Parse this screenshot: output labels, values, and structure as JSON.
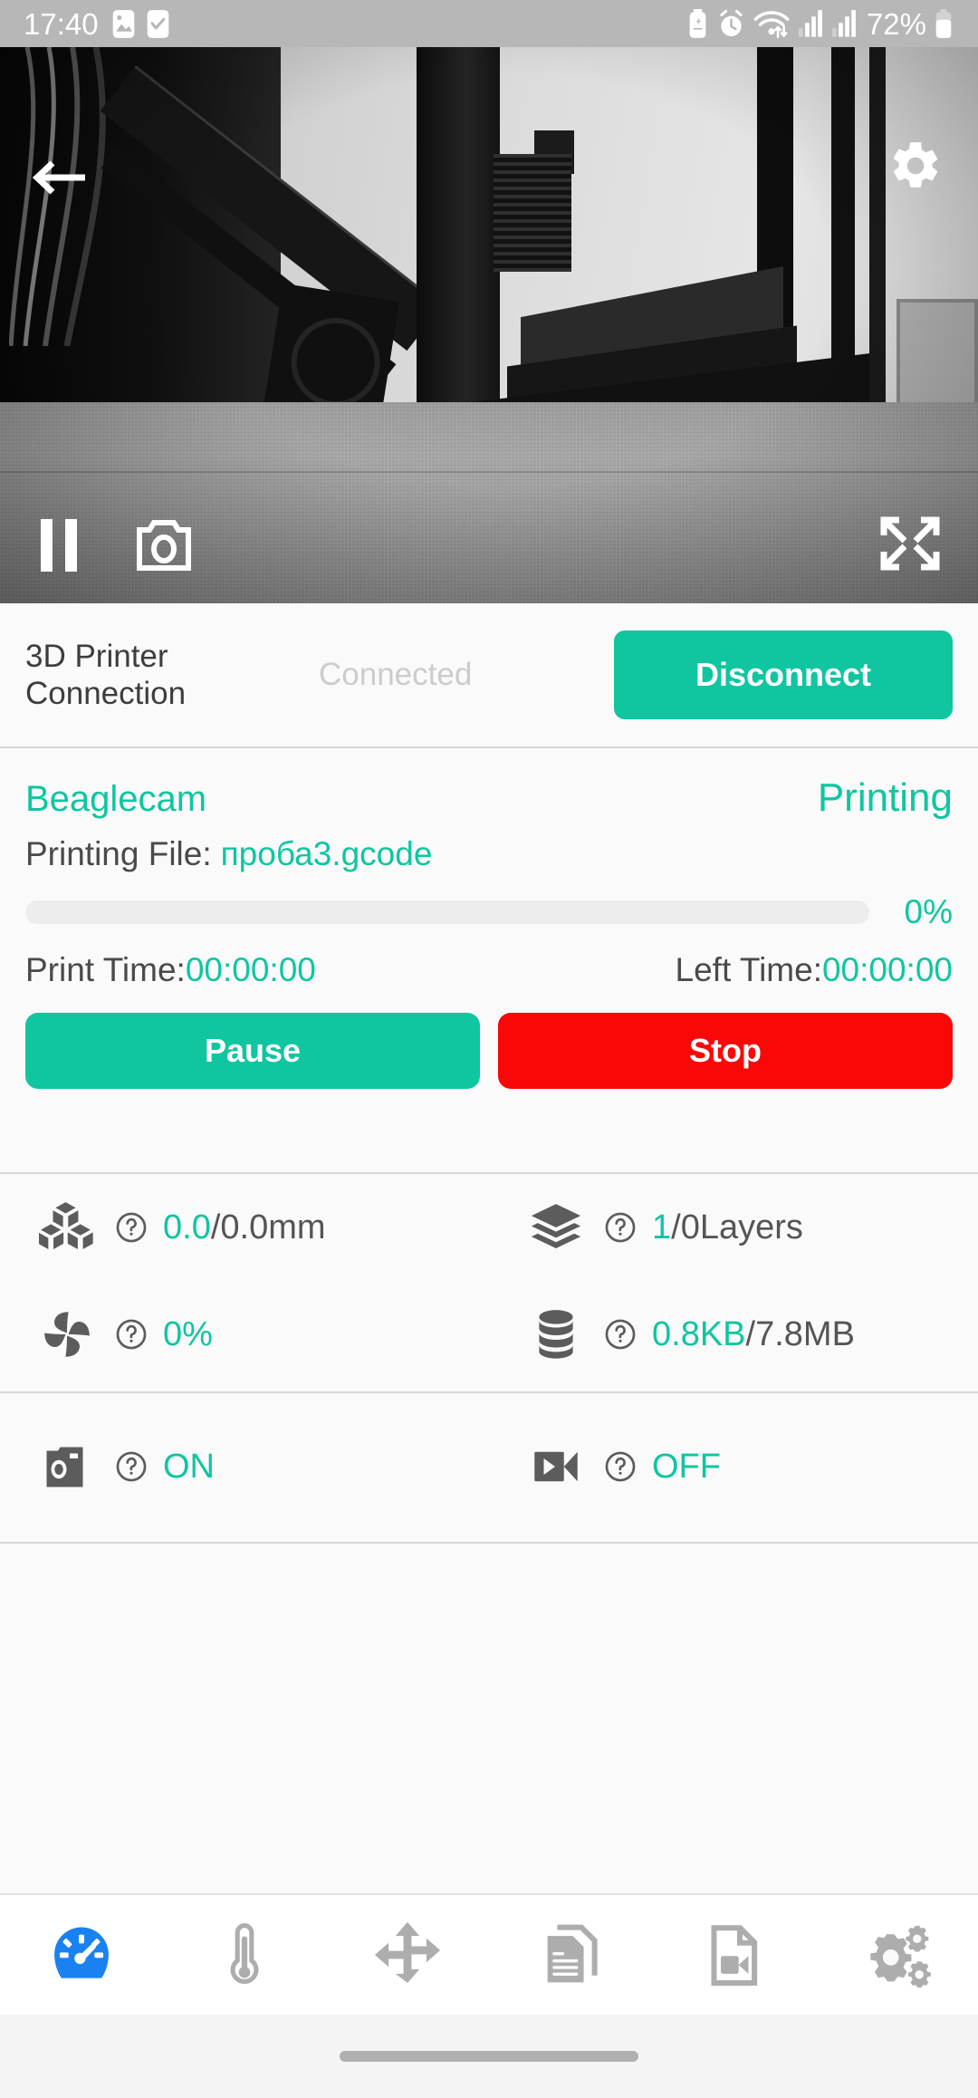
{
  "statusbar": {
    "clock": "17:40",
    "battery_percent": "72%",
    "icons": [
      "image-icon",
      "checkbox-icon",
      "battery-saver-icon",
      "alarm-icon",
      "wifi-icon",
      "signal-1-icon",
      "signal-2-icon",
      "battery-icon"
    ]
  },
  "camera": {
    "back_icon": "back-arrow-icon",
    "settings_icon": "gear-icon",
    "pause_icon": "pause-icon",
    "snapshot_icon": "camera-icon",
    "fullscreen_icon": "fullscreen-icon"
  },
  "connection": {
    "title": "3D Printer\nConnection",
    "title_line1": "3D Printer",
    "title_line2": "Connection",
    "status": "Connected",
    "button_label": "Disconnect"
  },
  "print": {
    "printer_name": "Beaglecam",
    "state": "Printing",
    "file_label": "Printing File:",
    "file_name": "проба3.gcode",
    "progress_percent": 0,
    "progress_text": "0%",
    "print_time_label": "Print Time:",
    "print_time_value": "00:00:00",
    "left_time_label": "Left Time:",
    "left_time_value": "00:00:00",
    "pause_label": "Pause",
    "stop_label": "Stop"
  },
  "stats": [
    {
      "icon": "cubes-icon",
      "help_icon": "question-mark-icon",
      "value": "0.0",
      "rest": "/0.0mm"
    },
    {
      "icon": "layers-icon",
      "help_icon": "question-mark-icon",
      "value": "1",
      "rest": "/0Layers"
    },
    {
      "icon": "fan-icon",
      "help_icon": "question-mark-icon",
      "value": "0%",
      "rest": ""
    },
    {
      "icon": "database-icon",
      "help_icon": "question-mark-icon",
      "value": "0.8KB",
      "rest": "/7.8MB"
    }
  ],
  "toggles": [
    {
      "icon": "photo-camera-icon",
      "help_icon": "question-mark-icon",
      "value": "ON",
      "rest": ""
    },
    {
      "icon": "video-camera-icon",
      "help_icon": "question-mark-icon",
      "value": "OFF",
      "rest": ""
    }
  ],
  "bottom_nav": {
    "items": [
      {
        "name": "dashboard",
        "icon": "gauge-icon",
        "active": true
      },
      {
        "name": "temperature",
        "icon": "thermometer-icon",
        "active": false
      },
      {
        "name": "move",
        "icon": "move-arrows-icon",
        "active": false
      },
      {
        "name": "files",
        "icon": "documents-icon",
        "active": false
      },
      {
        "name": "video",
        "icon": "video-file-icon",
        "active": false
      },
      {
        "name": "settings",
        "icon": "gears-icon",
        "active": false
      }
    ]
  },
  "colors": {
    "accent": "#0fc6a0",
    "danger": "#fa0707",
    "nav_active": "#1a82f0",
    "nav_inactive": "#adadad",
    "statusbar_bg": "#b7b7b7",
    "page_bg": "#fafafa",
    "muted_text": "#cccccc",
    "body_text": "#4a4a4a"
  }
}
